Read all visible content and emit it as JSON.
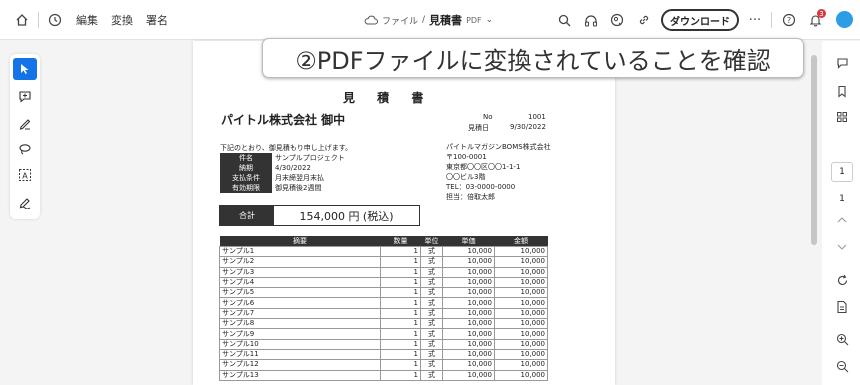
{
  "toolbar": {
    "home_icon": "home-icon",
    "history_icon": "history-icon",
    "menu": [
      "編集",
      "変換",
      "署名"
    ],
    "breadcrumb": {
      "folder": "ファイル",
      "separator": "/",
      "filename": "見積書",
      "filetype": "PDF",
      "chevron": "⌄"
    },
    "icons": [
      "search-icon",
      "headphones-icon",
      "share-icon",
      "link-icon"
    ],
    "download_label": "ダウンロード",
    "more_label": "···",
    "notification_count": "3"
  },
  "left_tools": [
    "select-tool",
    "comment-tool",
    "draw-tool",
    "lasso-tool",
    "text-select-tool",
    "sign-tool"
  ],
  "callout": "②PDFファイルに変換されていることを確認",
  "document": {
    "title": "見 積 書",
    "client": "パイトル株式会社 御中",
    "no_label": "No",
    "no_value": "1001",
    "date_label": "見積日",
    "date_value": "9/30/2022",
    "intro": "下記のとおり、御見積もり申し上げます。",
    "info": [
      {
        "key": "件名",
        "value": "サンプルプロジェクト"
      },
      {
        "key": "納期",
        "value": "4/30/2022"
      },
      {
        "key": "支払条件",
        "value": "月末締翌月末払"
      },
      {
        "key": "有効期限",
        "value": "御見積後2週間"
      }
    ],
    "issuer": [
      "パイトルマガジンBOMS株式会社",
      "〒100-0001",
      "東京都〇〇区〇〇1-1-1",
      "〇〇ビル3階",
      "TEL：03-0000-0000",
      "担当：倍取太郎"
    ],
    "total_label": "合計",
    "total_value": "154,000 円 (税込)",
    "columns": [
      "摘要",
      "数量",
      "単位",
      "単価",
      "金額"
    ],
    "rows": [
      [
        "サンプル1",
        "1",
        "式",
        "10,000",
        "10,000"
      ],
      [
        "サンプル2",
        "1",
        "式",
        "10,000",
        "10,000"
      ],
      [
        "サンプル3",
        "1",
        "式",
        "10,000",
        "10,000"
      ],
      [
        "サンプル4",
        "1",
        "式",
        "10,000",
        "10,000"
      ],
      [
        "サンプル5",
        "1",
        "式",
        "10,000",
        "10,000"
      ],
      [
        "サンプル6",
        "1",
        "式",
        "10,000",
        "10,000"
      ],
      [
        "サンプル7",
        "1",
        "式",
        "10,000",
        "10,000"
      ],
      [
        "サンプル8",
        "1",
        "式",
        "10,000",
        "10,000"
      ],
      [
        "サンプル9",
        "1",
        "式",
        "10,000",
        "10,000"
      ],
      [
        "サンプル10",
        "1",
        "式",
        "10,000",
        "10,000"
      ],
      [
        "サンプル11",
        "1",
        "式",
        "10,000",
        "10,000"
      ],
      [
        "サンプル12",
        "1",
        "式",
        "10,000",
        "10,000"
      ],
      [
        "サンプル13",
        "1",
        "式",
        "10,000",
        "10,000"
      ]
    ]
  },
  "right_rail": {
    "page_current": "1",
    "page_total": "1"
  },
  "colors": {
    "accent": "#1473e6",
    "badge": "#d7373f",
    "avatar": "#2d9de6"
  }
}
